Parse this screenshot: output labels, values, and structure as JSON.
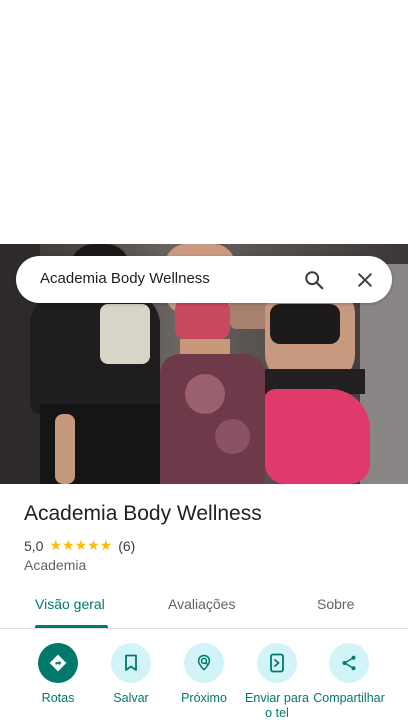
{
  "search": {
    "query": "Academia Body Wellness",
    "search_icon": "search-icon",
    "clear_icon": "close-icon"
  },
  "place": {
    "name": "Academia Body Wellness",
    "rating_value": "5,0",
    "stars": "★★★★★",
    "review_count": "(6)",
    "category": "Academia"
  },
  "tabs": [
    {
      "label": "Visão geral",
      "active": true
    },
    {
      "label": "Avaliações",
      "active": false
    },
    {
      "label": "Sobre",
      "active": false
    }
  ],
  "actions": [
    {
      "label": "Rotas",
      "icon": "directions-icon"
    },
    {
      "label": "Salvar",
      "icon": "bookmark-icon"
    },
    {
      "label": "Próximo",
      "icon": "nearby-icon"
    },
    {
      "label": "Enviar para o tel",
      "icon": "send-to-phone-icon"
    },
    {
      "label": "Compartilhar",
      "icon": "share-icon"
    }
  ],
  "colors": {
    "accent": "#00796b",
    "star": "#fbbc04",
    "action_bg": "#d2f3f7"
  }
}
